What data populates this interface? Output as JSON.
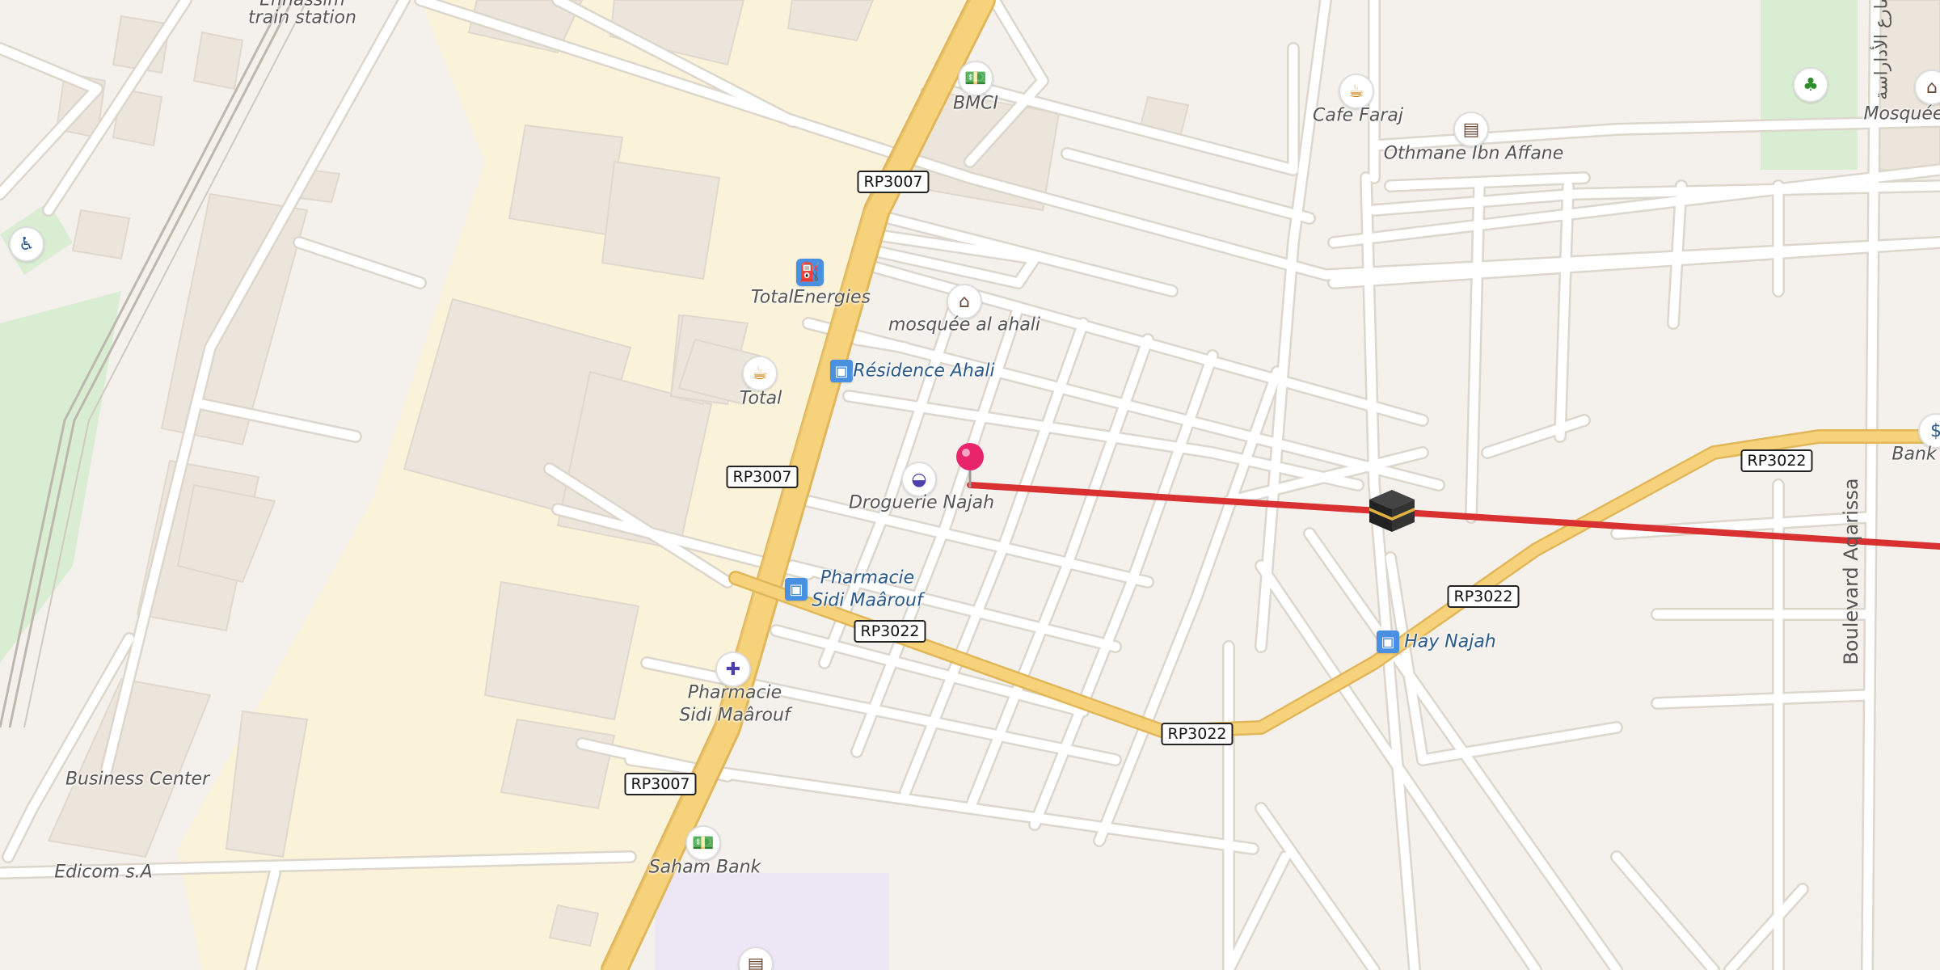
{
  "map": {
    "labels": {
      "train_station_top": "Ennassim",
      "train_station": "train station",
      "bmci": "BMCI",
      "cafe_faraj": "Cafe Faraj",
      "othmane": "Othmane Ibn Affane",
      "mosquee_right": "Mosquée",
      "totalenergies": "TotalEnergies",
      "mosquee_ahali": "mosquée al ahali",
      "residence_ahali": "Résidence Ahali",
      "total": "Total",
      "droguerie": "Droguerie Najah",
      "pharmacie_bus_1": "Pharmacie",
      "pharmacie_bus_2": "Sidi Maârouf",
      "pharmacie_1": "Pharmacie",
      "pharmacie_2": "Sidi Maârouf",
      "hay_najah": "Hay Najah",
      "bank": "Bank",
      "business_center": "Business Center",
      "edicom": "Edicom s.A",
      "saham_bank": "Saham Bank",
      "boulevard": "Boulevard Aqarissa",
      "arabic_top": "شارع الأداراسة"
    },
    "shields": {
      "rp3007_a": "RP3007",
      "rp3007_b": "RP3007",
      "rp3007_c": "RP3007",
      "rp3022_a": "RP3022",
      "rp3022_b": "RP3022",
      "rp3022_c": "RP3022",
      "rp3022_d": "RP3022"
    },
    "colors": {
      "background": "#f4f1ec",
      "industrial": "#fbf3d9",
      "park": "#d9edd3",
      "building": "#ece5dc",
      "primary_road": "#f6d27a",
      "route_line": "#d93131",
      "pin": "#e8246a"
    },
    "icons": {
      "bank": "banknote-icon",
      "cafe": "coffee-cup-icon",
      "school": "book-icon",
      "fuel": "fuel-pump-icon",
      "mosque": "mosque-icon",
      "bus": "bus-icon",
      "shop": "shopping-basket-icon",
      "pharmacy": "pharmacy-icon",
      "park": "tree-icon",
      "disabled": "wheelchair-icon",
      "kaaba": "kaaba-icon",
      "pin": "location-pin-icon"
    }
  }
}
